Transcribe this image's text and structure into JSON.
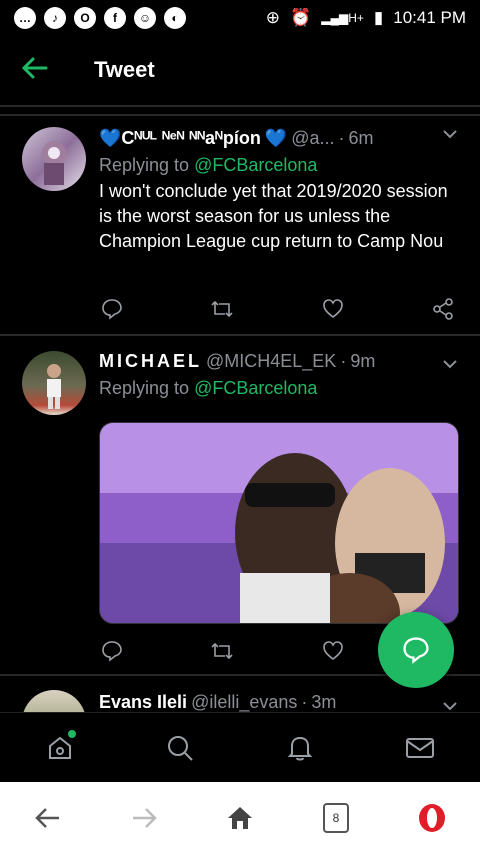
{
  "status_bar": {
    "time": "10:41 PM",
    "network": "H+"
  },
  "app_bar": {
    "title": "Tweet"
  },
  "tweets": [
    {
      "display_name": "Cᴺᵁᴸ ᴺᵉᴺ ᴺᴺaᴺpíon",
      "handle": "@a...",
      "age": "6m",
      "reply_label": "Replying to",
      "reply_to": "@FCBarcelona",
      "text": "I won't conclude yet that 2019/2020 session is the worst season for us unless the Champion League cup return to Camp Nou"
    },
    {
      "display_name": "MICHAEL",
      "handle": "@MICH4EL_EK",
      "age": "9m",
      "reply_label": "Replying to",
      "reply_to": "@FCBarcelona"
    },
    {
      "display_name": "Evans Ileli",
      "handle": "@ilelli_evans",
      "age": "3m"
    }
  ],
  "browser": {
    "tab_count": "8"
  },
  "colors": {
    "accent": "#1fb964",
    "background": "#000000",
    "muted": "#8b8f96"
  }
}
